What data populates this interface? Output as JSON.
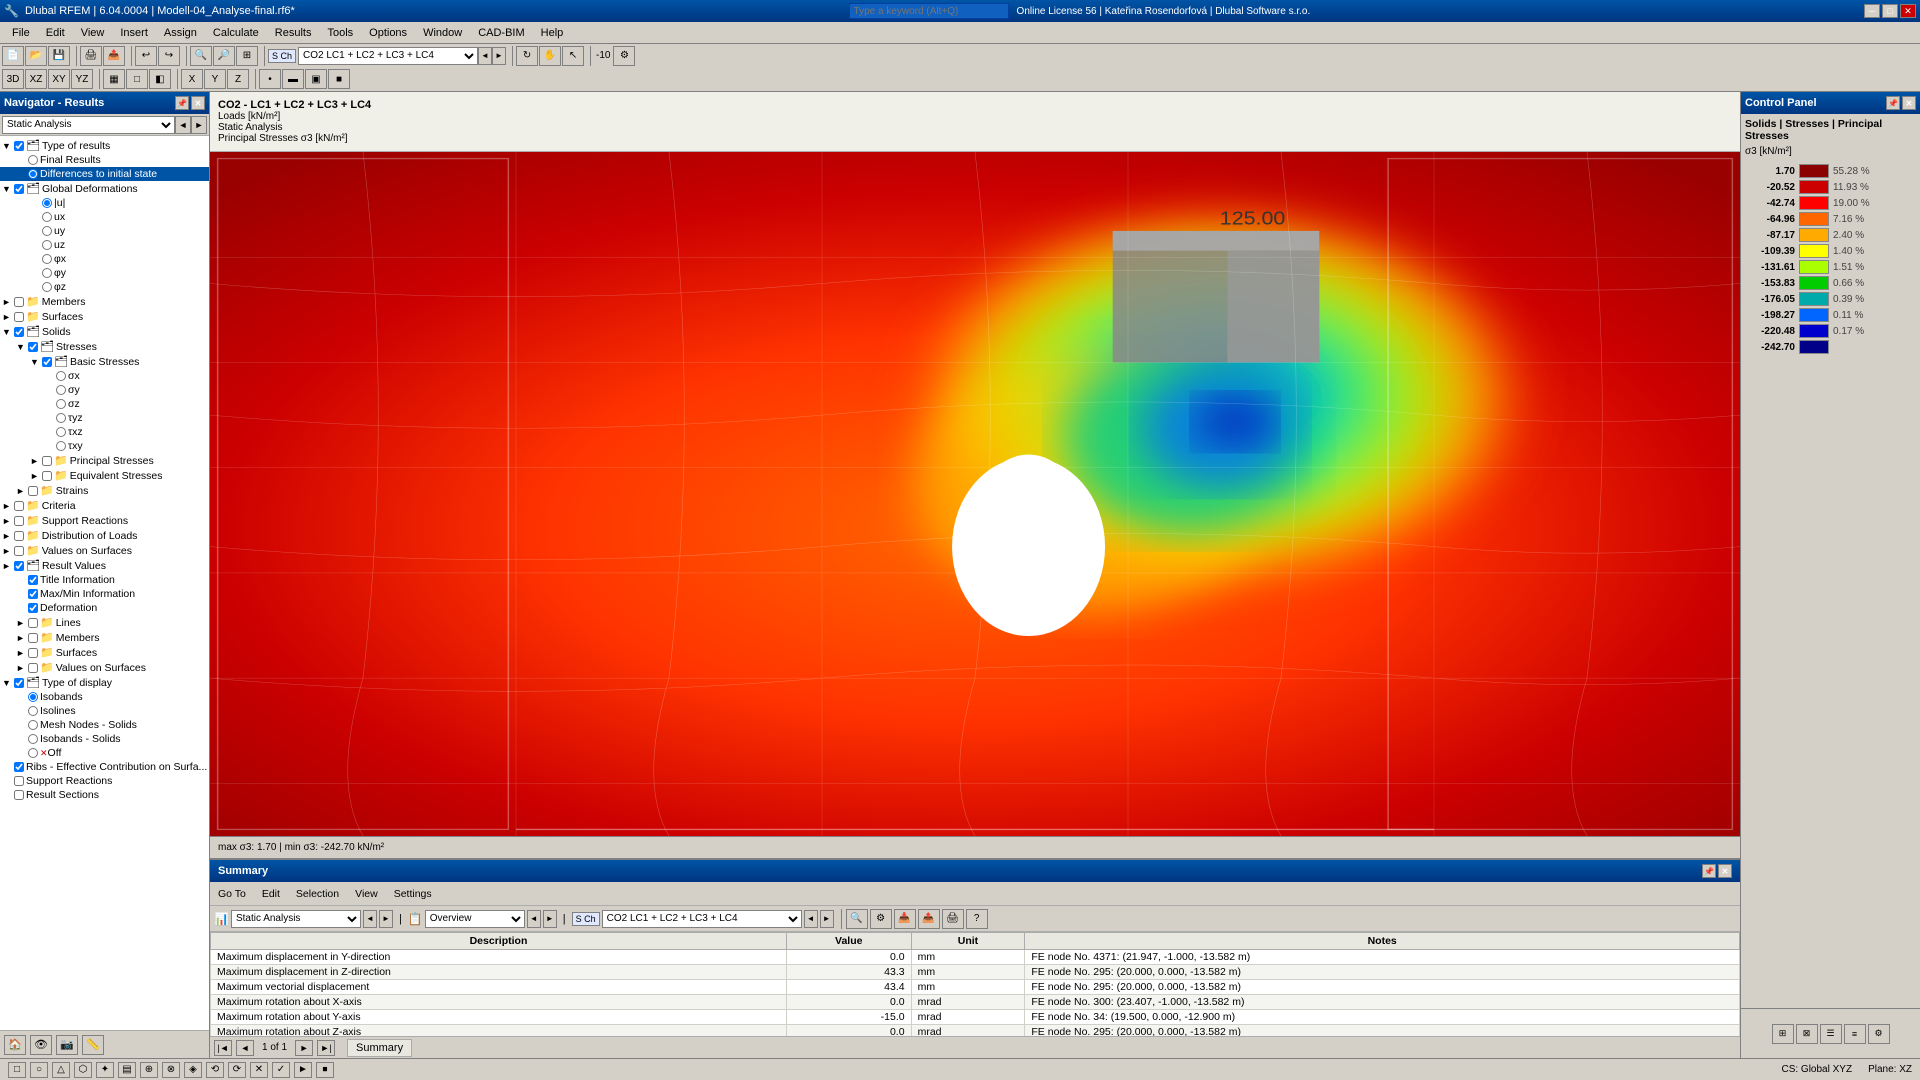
{
  "titlebar": {
    "title": "Dlubal RFEM | 6.04.0004 | Modell-04_Analyse-final.rf6*",
    "search_placeholder": "Type a keyword (Alt+Q)",
    "online_license": "Online License 56 | Kateřina Rosendorfová | Dlubal Software s.r.o.",
    "minimize": "─",
    "maximize": "□",
    "close": "✕"
  },
  "menubar": {
    "items": [
      "File",
      "Edit",
      "View",
      "Insert",
      "Assign",
      "Calculate",
      "Results",
      "Tools",
      "Options",
      "Window",
      "CAD-BIM",
      "Help"
    ]
  },
  "navigator": {
    "title": "Navigator - Results",
    "dropdown_value": "Static Analysis",
    "tree": [
      {
        "label": "Type of results",
        "indent": 0,
        "type": "folder",
        "expanded": true,
        "checked": true
      },
      {
        "label": "Final Results",
        "indent": 1,
        "type": "radio",
        "checked": false
      },
      {
        "label": "Differences to initial state",
        "indent": 1,
        "type": "radio",
        "checked": true,
        "selected": true
      },
      {
        "label": "Global Deformations",
        "indent": 0,
        "type": "folder",
        "expanded": true,
        "checked": true
      },
      {
        "label": "|u|",
        "indent": 2,
        "type": "radio",
        "checked": true
      },
      {
        "label": "ux",
        "indent": 2,
        "type": "radio",
        "checked": false
      },
      {
        "label": "uy",
        "indent": 2,
        "type": "radio",
        "checked": false
      },
      {
        "label": "uz",
        "indent": 2,
        "type": "radio",
        "checked": false
      },
      {
        "label": "φx",
        "indent": 2,
        "type": "radio",
        "checked": false
      },
      {
        "label": "φy",
        "indent": 2,
        "type": "radio",
        "checked": false
      },
      {
        "label": "φz",
        "indent": 2,
        "type": "radio",
        "checked": false
      },
      {
        "label": "Members",
        "indent": 0,
        "type": "folder",
        "expanded": false,
        "checked": false
      },
      {
        "label": "Surfaces",
        "indent": 0,
        "type": "folder",
        "expanded": false,
        "checked": false
      },
      {
        "label": "Solids",
        "indent": 0,
        "type": "folder",
        "expanded": true,
        "checked": true
      },
      {
        "label": "Stresses",
        "indent": 1,
        "type": "folder",
        "expanded": true,
        "checked": true
      },
      {
        "label": "Basic Stresses",
        "indent": 2,
        "type": "folder",
        "expanded": true,
        "checked": true
      },
      {
        "label": "σx",
        "indent": 3,
        "type": "radio",
        "checked": false
      },
      {
        "label": "σy",
        "indent": 3,
        "type": "radio",
        "checked": false
      },
      {
        "label": "σz",
        "indent": 3,
        "type": "radio",
        "checked": false
      },
      {
        "label": "τyz",
        "indent": 3,
        "type": "radio",
        "checked": false
      },
      {
        "label": "τxz",
        "indent": 3,
        "type": "radio",
        "checked": false
      },
      {
        "label": "τxy",
        "indent": 3,
        "type": "radio",
        "checked": false
      },
      {
        "label": "Principal Stresses",
        "indent": 2,
        "type": "folder",
        "expanded": false,
        "checked": false
      },
      {
        "label": "Equivalent Stresses",
        "indent": 2,
        "type": "folder",
        "expanded": false,
        "checked": false
      },
      {
        "label": "Strains",
        "indent": 1,
        "type": "folder",
        "expanded": false,
        "checked": false
      },
      {
        "label": "Criteria",
        "indent": 0,
        "type": "folder",
        "expanded": false,
        "checked": false
      },
      {
        "label": "Support Reactions",
        "indent": 0,
        "type": "folder",
        "expanded": false,
        "checked": false
      },
      {
        "label": "Distribution of Loads",
        "indent": 0,
        "type": "folder",
        "expanded": false,
        "checked": false
      },
      {
        "label": "Values on Surfaces",
        "indent": 0,
        "type": "folder",
        "expanded": false,
        "checked": false
      },
      {
        "label": "Result Values",
        "indent": 0,
        "type": "folder",
        "expanded": false,
        "checked": true
      },
      {
        "label": "Title Information",
        "indent": 1,
        "type": "check",
        "checked": true
      },
      {
        "label": "Max/Min Information",
        "indent": 1,
        "type": "check",
        "checked": true
      },
      {
        "label": "Deformation",
        "indent": 1,
        "type": "check",
        "checked": true
      },
      {
        "label": "Lines",
        "indent": 1,
        "type": "folder",
        "expanded": false,
        "checked": false
      },
      {
        "label": "Members",
        "indent": 1,
        "type": "folder",
        "expanded": false,
        "checked": false
      },
      {
        "label": "Surfaces",
        "indent": 1,
        "type": "folder",
        "expanded": false,
        "checked": false
      },
      {
        "label": "Values on Surfaces",
        "indent": 1,
        "type": "folder",
        "expanded": false,
        "checked": false
      },
      {
        "label": "Type of display",
        "indent": 0,
        "type": "folder",
        "expanded": true,
        "checked": true
      },
      {
        "label": "Isobands",
        "indent": 1,
        "type": "radio",
        "checked": true
      },
      {
        "label": "Isolines",
        "indent": 1,
        "type": "radio",
        "checked": false
      },
      {
        "label": "Mesh Nodes - Solids",
        "indent": 1,
        "type": "radio",
        "checked": false
      },
      {
        "label": "Isobands - Solids",
        "indent": 1,
        "type": "radio",
        "checked": false
      },
      {
        "label": "Off",
        "indent": 1,
        "type": "radio-x",
        "checked": false
      },
      {
        "label": "Ribs - Effective Contribution on Surfa...",
        "indent": 0,
        "type": "check",
        "checked": true
      },
      {
        "label": "Support Reactions",
        "indent": 0,
        "type": "check",
        "checked": false
      },
      {
        "label": "Result Sections",
        "indent": 0,
        "type": "check",
        "checked": false
      }
    ]
  },
  "viewport": {
    "header_line1": "CO2 - LC1 + LC2 + LC3 + LC4",
    "header_line2": "Loads [kN/m²]",
    "header_line3": "Static Analysis",
    "header_line4": "Principal Stresses σ3 [kN/m²]",
    "status_text": "max σ3: 1.70 | min σ3: -242.70 kN/m²"
  },
  "legend": {
    "title": "Solids | Stresses | Principal Stresses",
    "subtitle": "σ3 [kN/m²]",
    "items": [
      {
        "value": "1.70",
        "color": "#8b0000",
        "pct": "55.28 %"
      },
      {
        "value": "-20.52",
        "color": "#cc0000",
        "pct": "11.93 %"
      },
      {
        "value": "-42.74",
        "color": "#ff0000",
        "pct": "19.00 %"
      },
      {
        "value": "-64.96",
        "color": "#ff6600",
        "pct": "7.16 %"
      },
      {
        "value": "-87.17",
        "color": "#ffaa00",
        "pct": "2.40 %"
      },
      {
        "value": "-109.39",
        "color": "#ffff00",
        "pct": "1.40 %"
      },
      {
        "value": "-131.61",
        "color": "#aaff00",
        "pct": "1.51 %"
      },
      {
        "value": "-153.83",
        "color": "#00cc00",
        "pct": "0.66 %"
      },
      {
        "value": "-176.05",
        "color": "#00aaaa",
        "pct": "0.39 %"
      },
      {
        "value": "-198.27",
        "color": "#0066ff",
        "pct": "0.11 %"
      },
      {
        "value": "-220.48",
        "color": "#0000cc",
        "pct": "0.17 %"
      },
      {
        "value": "-242.70",
        "color": "#000088",
        "pct": ""
      }
    ]
  },
  "summary": {
    "title": "Summary",
    "menu_items": [
      "Go To",
      "Edit",
      "Selection",
      "View",
      "Settings"
    ],
    "analysis_type": "Static Analysis",
    "view_type": "Overview",
    "load_combo": "S Ch  CO2   LC1 + LC2 + LC3 + LC4",
    "columns": [
      "Description",
      "Value",
      "Unit",
      "Notes"
    ],
    "rows": [
      {
        "description": "Maximum displacement in Y-direction",
        "value": "0.0",
        "unit": "mm",
        "notes": "FE node No. 4371: (21.947, -1.000, -13.582 m)"
      },
      {
        "description": "Maximum displacement in Z-direction",
        "value": "43.3",
        "unit": "mm",
        "notes": "FE node No. 295: (20.000, 0.000, -13.582 m)"
      },
      {
        "description": "Maximum vectorial displacement",
        "value": "43.4",
        "unit": "mm",
        "notes": "FE node No. 295: (20.000, 0.000, -13.582 m)"
      },
      {
        "description": "Maximum rotation about X-axis",
        "value": "0.0",
        "unit": "mrad",
        "notes": "FE node No. 300: (23.407, -1.000, -13.582 m)"
      },
      {
        "description": "Maximum rotation about Y-axis",
        "value": "-15.0",
        "unit": "mrad",
        "notes": "FE node No. 34: (19.500, 0.000, -12.900 m)"
      },
      {
        "description": "Maximum rotation about Z-axis",
        "value": "0.0",
        "unit": "mrad",
        "notes": "FE node No. 295: (20.000, 0.000, -13.582 m)"
      }
    ],
    "page_info": "1 of 1",
    "tab_label": "Summary"
  },
  "statusbar": {
    "left": "",
    "cs": "CS: Global XYZ",
    "plane": "Plane: XZ"
  },
  "control_panel": {
    "title": "Control Panel"
  },
  "load_combo_bar": "S Ch  CO2   LC1 + LC2 + LC3 + LC4"
}
